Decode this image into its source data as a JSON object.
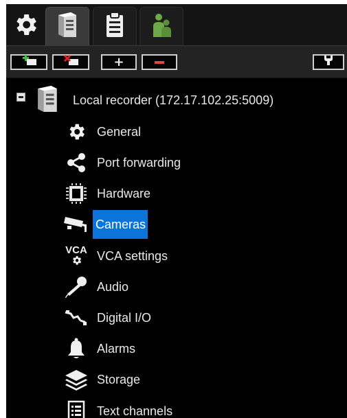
{
  "tabs": [
    {
      "name": "settings",
      "icon": "gear-icon"
    },
    {
      "name": "devices",
      "icon": "server-icon",
      "active": true
    },
    {
      "name": "layouts",
      "icon": "clipboard-icon"
    },
    {
      "name": "users",
      "icon": "users-icon"
    }
  ],
  "toolbar": {
    "buttons": [
      {
        "name": "add-recorder",
        "icon": "add-server-icon"
      },
      {
        "name": "remove-recorder",
        "icon": "remove-server-icon"
      },
      {
        "name": "expand-all",
        "icon": "plus-icon"
      },
      {
        "name": "collapse-all",
        "icon": "minus-icon"
      },
      {
        "name": "tools",
        "icon": "wrench-icon"
      }
    ]
  },
  "tree": {
    "recorder": {
      "label": "Local recorder (172.17.102.25:5009)",
      "expanded": true
    },
    "items": [
      {
        "label": "General",
        "icon": "gear-icon"
      },
      {
        "label": "Port forwarding",
        "icon": "share-icon"
      },
      {
        "label": "Hardware",
        "icon": "chip-icon"
      },
      {
        "label": "Cameras",
        "icon": "camera-icon",
        "selected": true
      },
      {
        "label": "VCA settings",
        "icon": "vca-icon"
      },
      {
        "label": "Audio",
        "icon": "microphone-icon"
      },
      {
        "label": "Digital I/O",
        "icon": "io-icon"
      },
      {
        "label": "Alarms",
        "icon": "bell-icon"
      },
      {
        "label": "Storage",
        "icon": "layers-icon"
      },
      {
        "label": "Text channels",
        "icon": "list-icon"
      }
    ]
  },
  "colors": {
    "background": "#000000",
    "selection": "#0a74da",
    "text": "#e8e8e8",
    "users_icon": "#6fa84a"
  }
}
